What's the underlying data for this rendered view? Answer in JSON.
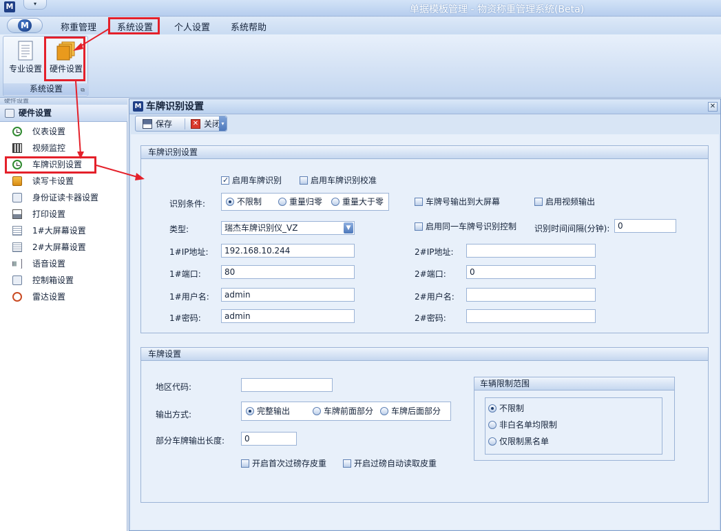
{
  "titlebar": {
    "logo": "M",
    "qat": "▾",
    "title": "单据模板管理 - 物资称重管理系统(Beta)"
  },
  "menubar": {
    "orb": "M",
    "items": [
      "称重管理",
      "系统设置",
      "个人设置",
      "系统帮助"
    ]
  },
  "ribbon": {
    "buttons": [
      {
        "label": "专业设置",
        "icon": "document-list-icon"
      },
      {
        "label": "硬件设置",
        "icon": "folders-icon"
      }
    ],
    "group_label": "系统设置",
    "launcher": "⧉"
  },
  "sidebar": {
    "tab": "硬件设置",
    "header": "硬件设置",
    "items": [
      {
        "label": "仪表设置",
        "icon": "gauge-icon"
      },
      {
        "label": "视频监控",
        "icon": "film-icon"
      },
      {
        "label": "车牌识别设置",
        "icon": "gauge-icon"
      },
      {
        "label": "读写卡设置",
        "icon": "card-icon"
      },
      {
        "label": "身份证读卡器设置",
        "icon": "search-icon"
      },
      {
        "label": "打印设置",
        "icon": "printer-icon"
      },
      {
        "label": "1#大屏幕设置",
        "icon": "document-icon"
      },
      {
        "label": "2#大屏幕设置",
        "icon": "document-icon"
      },
      {
        "label": "语音设置",
        "icon": "speaker-icon"
      },
      {
        "label": "控制箱设置",
        "icon": "search-icon"
      },
      {
        "label": "雷达设置",
        "icon": "radar-icon"
      }
    ]
  },
  "dialog": {
    "logo": "M",
    "title": "车牌识别设置",
    "close": "✕",
    "toolbar": {
      "save": "保存",
      "close": "关闭",
      "close_glyph": "✕",
      "more": "▾"
    }
  },
  "recognition": {
    "title": "车牌识别设置",
    "enable": {
      "label": "启用车牌识别",
      "checked": true
    },
    "enable_verify": {
      "label": "启用车牌识别校准",
      "checked": false
    },
    "condition_label": "识别条件:",
    "conditions": [
      {
        "label": "不限制",
        "selected": true
      },
      {
        "label": "重量归零",
        "selected": false
      },
      {
        "label": "重量大于零",
        "selected": false
      }
    ],
    "output_screen": {
      "label": "车牌号输出到大屏幕",
      "checked": false
    },
    "video_output": {
      "label": "启用视频输出",
      "checked": false
    },
    "type_label": "类型:",
    "type_value": "瑞杰车牌识别仪_VZ",
    "same_plate": {
      "label": "启用同一车牌号识别控制",
      "checked": false
    },
    "interval_label": "识别时间间隔(分钟):",
    "interval_value": "0",
    "ip1_label": "1#IP地址:",
    "ip1_value": "192.168.10.244",
    "ip2_label": "2#IP地址:",
    "ip2_value": "",
    "port1_label": "1#端口:",
    "port1_value": "80",
    "port2_label": "2#端口:",
    "port2_value": "0",
    "user1_label": "1#用户名:",
    "user1_value": "admin",
    "user2_label": "2#用户名:",
    "user2_value": "",
    "pwd1_label": "1#密码:",
    "pwd1_value": "admin",
    "pwd2_label": "2#密码:",
    "pwd2_value": ""
  },
  "plate": {
    "title": "车牌设置",
    "region_label": "地区代码:",
    "region_value": "",
    "output_label": "输出方式:",
    "outputs": [
      {
        "label": "完整输出",
        "selected": true
      },
      {
        "label": "车牌前面部分",
        "selected": false
      },
      {
        "label": "车牌后面部分",
        "selected": false
      }
    ],
    "partial_label": "部分车牌输出长度:",
    "partial_value": "0",
    "first_tare": {
      "label": "开启首次过磅存皮重",
      "checked": false
    },
    "auto_tare": {
      "label": "开启过磅自动读取皮重",
      "checked": false
    },
    "limit": {
      "title": "车辆限制范围",
      "options": [
        {
          "label": "不限制",
          "selected": true
        },
        {
          "label": "非白名单均限制",
          "selected": false
        },
        {
          "label": "仅限制黑名单",
          "selected": false
        }
      ]
    }
  },
  "colors": {
    "highlight": "#e4202a",
    "accent": "#1f3f86"
  }
}
